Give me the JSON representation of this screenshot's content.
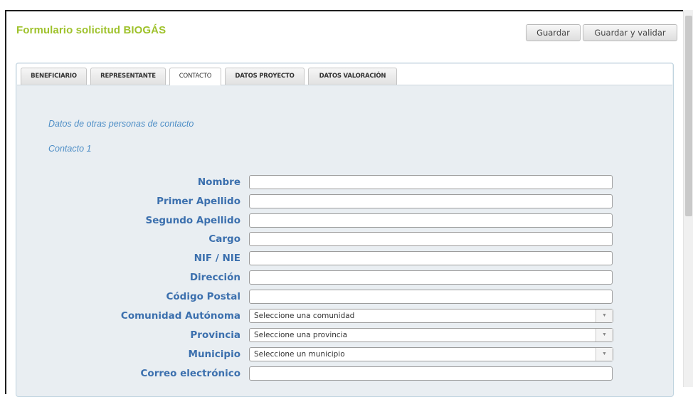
{
  "header": {
    "title": "Formulario solicitud BIOGÁS",
    "save_label": "Guardar",
    "save_validate_label": "Guardar y validar"
  },
  "tabs": [
    {
      "label": "BENEFICIARIO",
      "active": false
    },
    {
      "label": "REPRESENTANTE",
      "active": false
    },
    {
      "label": "CONTACTO",
      "active": true
    },
    {
      "label": "DATOS PROYECTO",
      "active": false
    },
    {
      "label": "DATOS VALORACIÓN",
      "active": false
    }
  ],
  "section": {
    "heading": "Datos de otras personas de contacto",
    "subheading": "Contacto 1"
  },
  "fields": {
    "nombre": {
      "label": "Nombre",
      "value": ""
    },
    "primer_apellido": {
      "label": "Primer Apellido",
      "value": ""
    },
    "segundo_apellido": {
      "label": "Segundo Apellido",
      "value": ""
    },
    "cargo": {
      "label": "Cargo",
      "value": ""
    },
    "nif": {
      "label": "NIF / NIE",
      "value": ""
    },
    "direccion": {
      "label": "Dirección",
      "value": ""
    },
    "codigo_postal": {
      "label": "Código Postal",
      "value": ""
    },
    "comunidad": {
      "label": "Comunidad Autónoma",
      "selected": "Seleccione una comunidad"
    },
    "provincia": {
      "label": "Provincia",
      "selected": "Seleccione una provincia"
    },
    "municipio": {
      "label": "Municipio",
      "selected": "Seleccione un municipio"
    },
    "correo": {
      "label": "Correo electrónico",
      "value": ""
    }
  },
  "colors": {
    "title": "#9fc22c",
    "label": "#3c70ae",
    "section_heading": "#4e8ec6",
    "panel_bg": "#e9eef2"
  },
  "icons": {
    "dropdown": "chevron-down-icon"
  }
}
